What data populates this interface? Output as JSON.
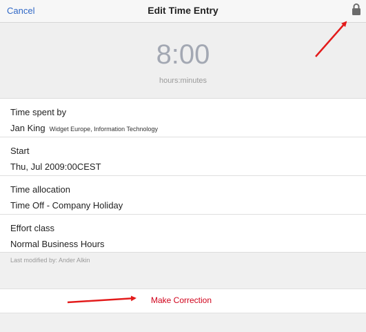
{
  "header": {
    "cancel_label": "Cancel",
    "title": "Edit Time Entry",
    "lock_icon": "lock-icon"
  },
  "duration": {
    "value": "8:00",
    "unit": "hours:minutes"
  },
  "fields": [
    {
      "label": "Time spent by",
      "value": "Jan King",
      "sub": "Widget Europe, Information Technology"
    },
    {
      "label": "Start",
      "value": "Thu, Jul 2009:00CEST"
    },
    {
      "label": "Time allocation",
      "value": "Time Off - Company Holiday"
    },
    {
      "label": "Effort class",
      "value": "Normal Business Hours"
    }
  ],
  "footer": {
    "last_modified": "Last modified by: Ander Alkin",
    "correction_label": "Make Correction"
  },
  "colors": {
    "link_blue": "#2f67c6",
    "correction_red": "#d0021b",
    "annotation_red": "#e31b1b",
    "time_gray": "#a3a8b3"
  }
}
